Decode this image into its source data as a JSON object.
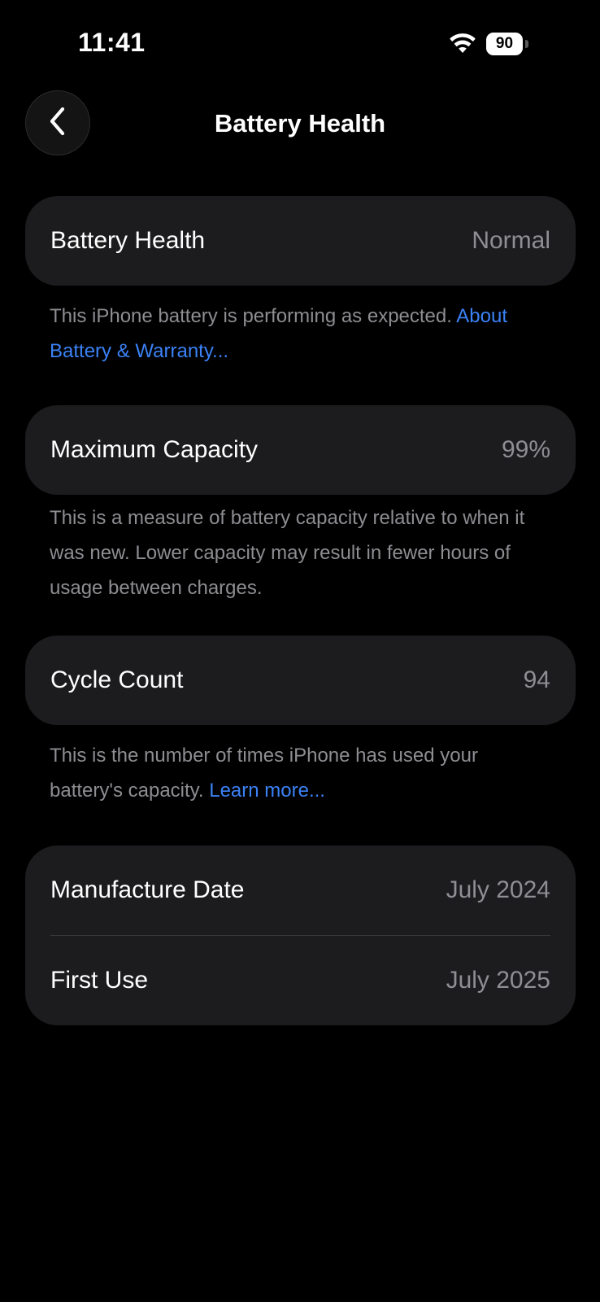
{
  "status_bar": {
    "time": "11:41",
    "battery_level": "90",
    "icons": [
      "wifi-icon",
      "battery-icon"
    ]
  },
  "nav": {
    "title": "Battery Health",
    "back_icon": "chevron-left-icon"
  },
  "sections": {
    "battery_health": {
      "label": "Battery Health",
      "value": "Normal",
      "footnote": "This iPhone battery is performing as expected. ",
      "footnote_link": "About Battery & Warranty..."
    },
    "maximum_capacity": {
      "label": "Maximum Capacity",
      "value": "99%",
      "footnote": "This is a measure of battery capacity relative to when it was new. Lower capacity may result in fewer hours of usage between charges."
    },
    "cycle_count": {
      "label": "Cycle Count",
      "value": "94",
      "footnote": "This is the number of times iPhone has used your battery's capacity. ",
      "footnote_link": "Learn more..."
    },
    "dates": {
      "manufacture_label": "Manufacture Date",
      "manufacture_value": "July 2024",
      "first_use_label": "First Use",
      "first_use_value": "July 2025"
    }
  },
  "colors": {
    "background": "#000000",
    "card": "#1c1c1e",
    "secondary_text": "#8e8e93",
    "link": "#3b82f6"
  }
}
